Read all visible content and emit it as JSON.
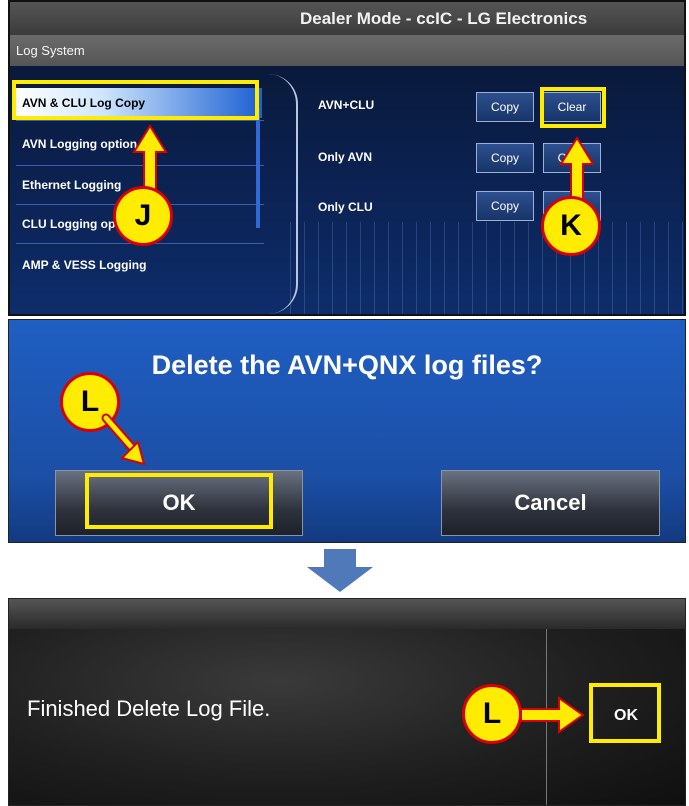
{
  "panel1": {
    "title": "Dealer Mode - ccIC - LG Electronics",
    "section": "Log System",
    "menu": [
      {
        "label": "AVN & CLU Log Copy",
        "active": true
      },
      {
        "label": "AVN Logging option"
      },
      {
        "label": "Ethernet Logging"
      },
      {
        "label": "CLU Logging option"
      },
      {
        "label": "AMP & VESS Logging"
      }
    ],
    "options": [
      {
        "label": "AVN+CLU",
        "copy": "Copy",
        "clear": "Clear"
      },
      {
        "label": "Only AVN",
        "copy": "Copy",
        "clear": "Clear"
      },
      {
        "label": "Only CLU",
        "copy": "Copy",
        "clear": "Clear"
      }
    ]
  },
  "panel2": {
    "question": "Delete the AVN+QNX log files?",
    "ok": "OK",
    "cancel": "Cancel"
  },
  "panel3": {
    "message": "Finished Delete Log File.",
    "ok": "OK"
  },
  "callouts": {
    "j": "J",
    "k": "K",
    "l1": "L",
    "l2": "L"
  },
  "colors": {
    "highlight": "#ffec00",
    "callout_border": "#d80000",
    "arrow_blue": "#4f79b8"
  }
}
